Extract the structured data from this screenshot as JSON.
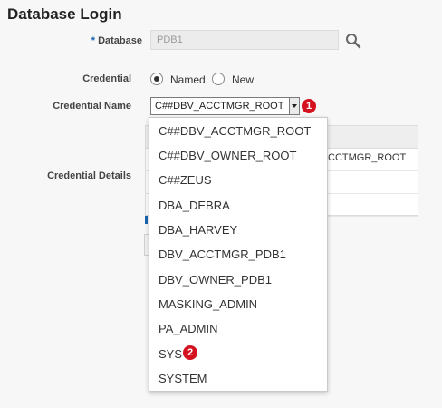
{
  "page": {
    "title": "Database Login"
  },
  "form": {
    "database": {
      "required_marker": "*",
      "label": "Database",
      "value": "PDB1"
    },
    "credential": {
      "label": "Credential",
      "options": [
        "Named",
        "New"
      ],
      "selected": "Named"
    },
    "credential_name": {
      "label": "Credential Name",
      "selected": "C##DBV_ACCTMGR_ROOT"
    },
    "credential_details": {
      "label": "Credential Details"
    }
  },
  "background": {
    "partial_value": "CCTMGR_ROOT"
  },
  "dropdown": {
    "options": [
      "C##DBV_ACCTMGR_ROOT",
      "C##DBV_OWNER_ROOT",
      "C##ZEUS",
      "DBA_DEBRA",
      "DBA_HARVEY",
      "DBV_ACCTMGR_PDB1",
      "DBV_OWNER_PDB1",
      "MASKING_ADMIN",
      "PA_ADMIN",
      "SYS",
      "SYSTEM"
    ]
  },
  "callouts": {
    "one": "1",
    "two": "2",
    "color": "#d4121f"
  }
}
